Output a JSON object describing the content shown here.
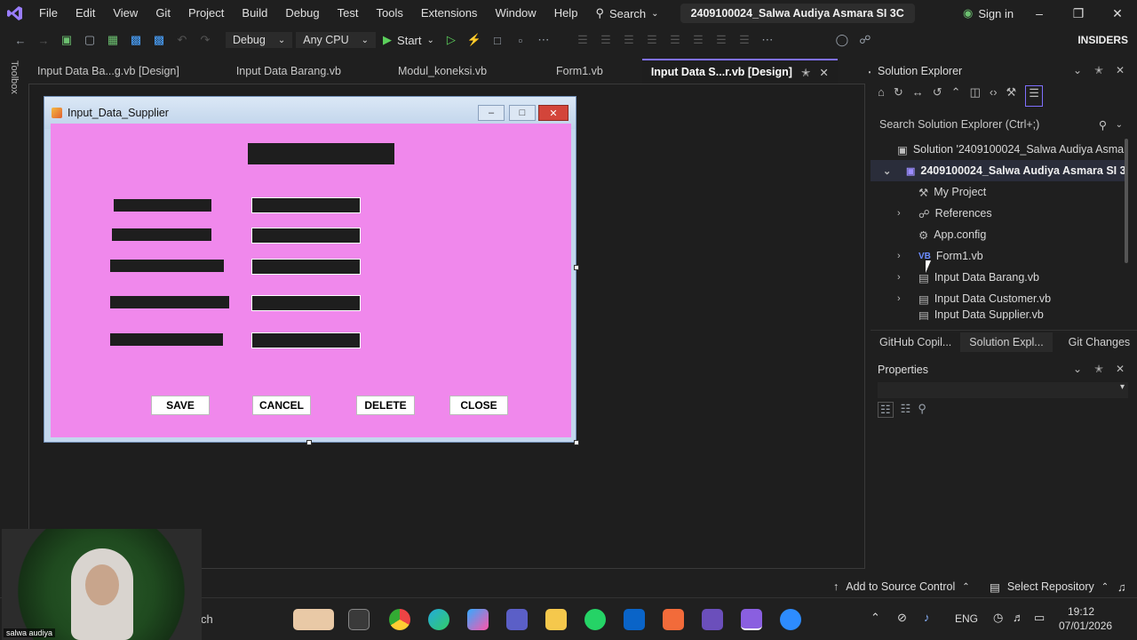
{
  "menubar": {
    "items": [
      "File",
      "Edit",
      "View",
      "Git",
      "Project",
      "Build",
      "Debug",
      "Test",
      "Tools",
      "Extensions",
      "Window",
      "Help"
    ],
    "search_label": "Search",
    "solution_title": "2409100024_Salwa Audiya Asmara SI 3C",
    "signin_label": "Sign in"
  },
  "toolbar": {
    "config": "Debug",
    "platform": "Any CPU",
    "start_label": "Start",
    "insiders_label": "INSIDERS"
  },
  "toolbox_label": "Toolbox",
  "tabs": [
    {
      "label": "Input Data Ba...g.vb [Design]"
    },
    {
      "label": "Input Data Barang.vb"
    },
    {
      "label": "Modul_koneksi.vb"
    },
    {
      "label": "Form1.vb"
    },
    {
      "label": "Input Data S...r.vb [Design]"
    }
  ],
  "form": {
    "title": "Input_Data_Supplier",
    "buttons": {
      "save": "SAVE",
      "cancel": "CANCEL",
      "delete": "DELETE",
      "close": "CLOSE"
    }
  },
  "solution_explorer": {
    "title": "Solution Explorer",
    "search_placeholder": "Search Solution Explorer (Ctrl+;)",
    "items": [
      {
        "label": "Solution '2409100024_Salwa Audiya Asmara"
      },
      {
        "label": "2409100024_Salwa Audiya Asmara SI 3C"
      },
      {
        "label": "My Project"
      },
      {
        "label": "References"
      },
      {
        "label": "App.config"
      },
      {
        "label": "Form1.vb"
      },
      {
        "label": "Input Data Barang.vb"
      },
      {
        "label": "Input Data Customer.vb"
      },
      {
        "label": "Input Data Supplier.vb"
      }
    ],
    "bottom_tabs": [
      "GitHub Copil...",
      "Solution Expl...",
      "Git Changes"
    ]
  },
  "properties": {
    "title": "Properties"
  },
  "statusbar": {
    "add_source_control": "Add to Source Control",
    "select_repository": "Select Repository"
  },
  "taskbar": {
    "search_text": "ch",
    "lang": "ENG",
    "time": "19:12",
    "date": "07/01/2026"
  },
  "webcam": {
    "name_label": "salwa audiya"
  },
  "colors": {
    "form_bg": "#f088ec",
    "accent": "#7f70ff"
  }
}
